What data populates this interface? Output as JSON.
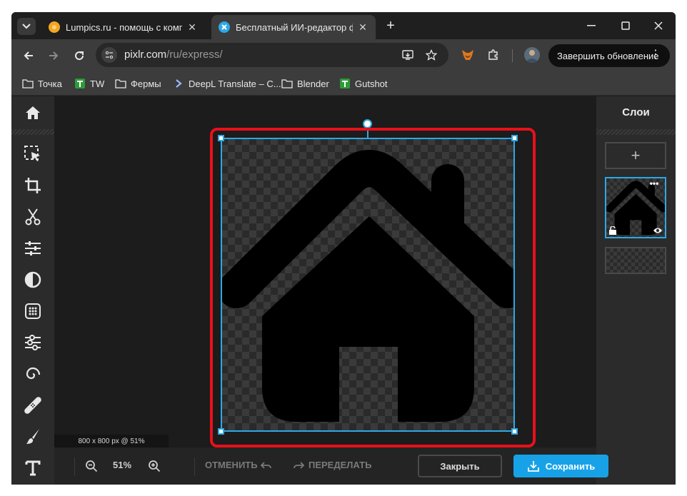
{
  "browser": {
    "tabs": [
      {
        "title": "Lumpics.ru - помощь с компьютером",
        "close": "✕"
      },
      {
        "title": "Бесплатный ИИ-редактор фото",
        "close": "✕"
      }
    ],
    "new_tab": "+",
    "url_host": "pixlr.com",
    "url_path": "/ru/express/",
    "update_button": "Завершить обновление",
    "menu_dots": "⋮",
    "bookmarks": [
      {
        "label": "Точка",
        "icon": "folder-icon"
      },
      {
        "label": "TW",
        "icon": "green-bookmark-icon"
      },
      {
        "label": "Фермы",
        "icon": "folder-icon"
      },
      {
        "label": "DeepL Translate – С...",
        "icon": "deepl-icon"
      },
      {
        "label": "Blender",
        "icon": "folder-icon"
      },
      {
        "label": "Gutshot",
        "icon": "green-bookmark-icon"
      }
    ]
  },
  "editor": {
    "status_text": "800 x 800 px @ 51%",
    "layers_title": "Слои",
    "add_layer": "+",
    "layer_menu": "•••",
    "zoom_value": "51%",
    "undo_label": "ОТМЕНИТЬ",
    "redo_label": "ПЕРЕДЕЛАТЬ",
    "close_label": "Закрыть",
    "save_label": "Сохранить",
    "tools": [
      "home-icon",
      "select-arrow-icon",
      "crop-icon",
      "scissors-icon",
      "adjust-sliders-icon",
      "contrast-icon",
      "filter-dots-icon",
      "effects-icon",
      "liquify-icon",
      "heal-icon",
      "brush-icon",
      "text-icon"
    ]
  },
  "colors": {
    "accent": "#17a2e8",
    "selection": "#2ea8e6",
    "highlight": "#e8101a"
  }
}
